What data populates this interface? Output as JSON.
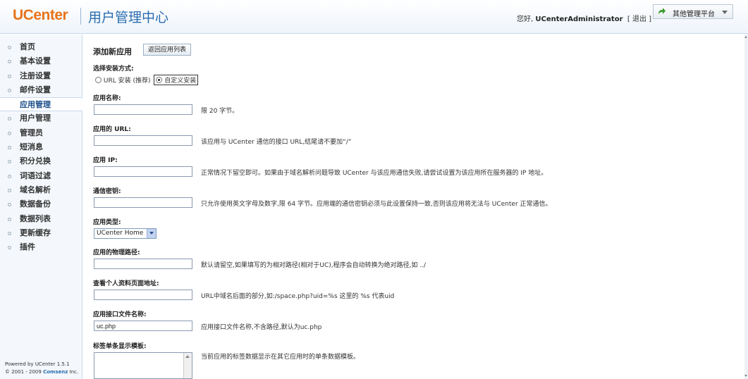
{
  "header": {
    "logo": "UCenter",
    "title": "用户管理中心",
    "greeting_prefix": "您好,",
    "username": "UCenterAdministrator",
    "logout_open": "[",
    "logout": "退出",
    "logout_close": "]",
    "platform_label": "其他管理平台"
  },
  "sidebar": {
    "items": [
      {
        "label": "首页"
      },
      {
        "label": "基本设置"
      },
      {
        "label": "注册设置"
      },
      {
        "label": "邮件设置"
      },
      {
        "label": "应用管理"
      },
      {
        "label": "用户管理"
      },
      {
        "label": "管理员"
      },
      {
        "label": "短消息"
      },
      {
        "label": "积分兑换"
      },
      {
        "label": "词语过滤"
      },
      {
        "label": "域名解析"
      },
      {
        "label": "数据备份"
      },
      {
        "label": "数据列表"
      },
      {
        "label": "更新缓存"
      },
      {
        "label": "插件"
      }
    ],
    "active": "应用管理",
    "footer_line1_prefix": "Powered by",
    "footer_line1_version": "UCenter 1.5.1",
    "footer_line2_prefix": "© 2001 - 2009",
    "footer_line2_brand": "Comsenz",
    "footer_line2_suffix": "Inc."
  },
  "main": {
    "title": "添加新应用",
    "back_button": "返回应用列表",
    "install_method_label": "选择安装方式:",
    "install_url": "URL 安装 (推荐)",
    "install_custom": "自定义安装",
    "fields": {
      "app_name_label": "应用名称:",
      "app_name_hint": "限 20 字节。",
      "app_url_label": "应用的 URL:",
      "app_url_hint": "该应用与 UCenter 通信的接口 URL,结尾请不要加“/”",
      "app_ip_label": "应用 IP:",
      "app_ip_hint": "正常情况下留空即可。如果由于域名解析问题导致 UCenter 与该应用通信失败,请尝试设置为该应用所在服务器的 IP 地址。",
      "comm_key_label": "通信密钥:",
      "comm_key_hint": "只允许使用英文字母及数字,限 64 字节。应用端的通信密钥必须与此设置保持一致,否则该应用将无法与 UCenter 正常通信。",
      "app_type_label": "应用类型:",
      "app_type_value": "UCenter Home",
      "app_path_label": "应用的物理路径:",
      "app_path_hint": "默认请留空,如果填写的为相对路径(相对于UC),程序会自动转换为绝对路径,如 ../",
      "profile_url_label": "查看个人资料页面地址:",
      "profile_url_hint": "URL中域名后面的部分,如:/space.php?uid=%s 这里的 %s 代表uid",
      "api_file_label": "应用接口文件名称:",
      "api_file_value": "uc.php",
      "api_file_hint": "应用接口文件名称,不含路径,默认为uc.php",
      "tag_template_label": "标签单条显示模板:",
      "tag_template_hint": "当前应用的标签数据显示在其它应用时的单条数据模板。"
    }
  },
  "colors": {
    "logo_orange": "#e8731a",
    "title_blue": "#2a6db0",
    "active_nav": "#1b4f8a"
  }
}
